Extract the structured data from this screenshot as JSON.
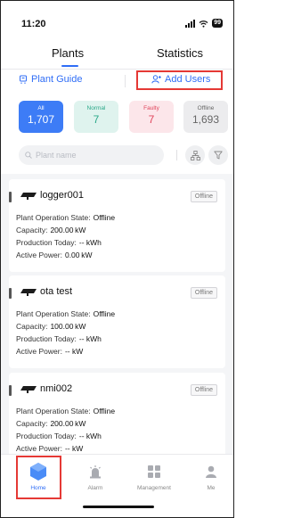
{
  "status_bar": {
    "time": "11:20",
    "battery": "99"
  },
  "top_tabs": [
    {
      "label": "Plants",
      "active": true
    },
    {
      "label": "Statistics",
      "active": false
    }
  ],
  "actions": {
    "plant_guide": "Plant Guide",
    "add_users": "Add Users"
  },
  "status_cards": {
    "all": {
      "label": "All",
      "value": "1,707"
    },
    "normal": {
      "label": "Normal",
      "value": "7"
    },
    "faulty": {
      "label": "Faulty",
      "value": "7"
    },
    "offline": {
      "label": "Offline",
      "value": "1,693"
    }
  },
  "search": {
    "placeholder": "Plant name"
  },
  "field_labels": {
    "state": "Plant Operation State:",
    "capacity": "Capacity:",
    "production": "Production Today:",
    "power": "Active Power:"
  },
  "plants": [
    {
      "name": "logger001",
      "status": "Offline",
      "state": "Offline",
      "capacity": "200.00 kW",
      "production": "-- kWh",
      "power": "0.00 kW"
    },
    {
      "name": "ota test",
      "status": "Offline",
      "state": "Offline",
      "capacity": "100.00 kW",
      "production": "-- kWh",
      "power": "-- kW"
    },
    {
      "name": "nmi002",
      "status": "Offline",
      "state": "Offline",
      "capacity": "200.00 kW",
      "production": "-- kWh",
      "power": "-- kW"
    }
  ],
  "bottom_nav": [
    {
      "label": "Home",
      "icon": "home-icon",
      "active": true
    },
    {
      "label": "Alarm",
      "icon": "alarm-icon",
      "active": false
    },
    {
      "label": "Management",
      "icon": "management-icon",
      "active": false
    },
    {
      "label": "Me",
      "icon": "me-icon",
      "active": false
    }
  ],
  "colors": {
    "accent": "#2f6df6",
    "normal": "#2aa889",
    "faulty": "#e0455c",
    "highlight": "#e53935"
  }
}
